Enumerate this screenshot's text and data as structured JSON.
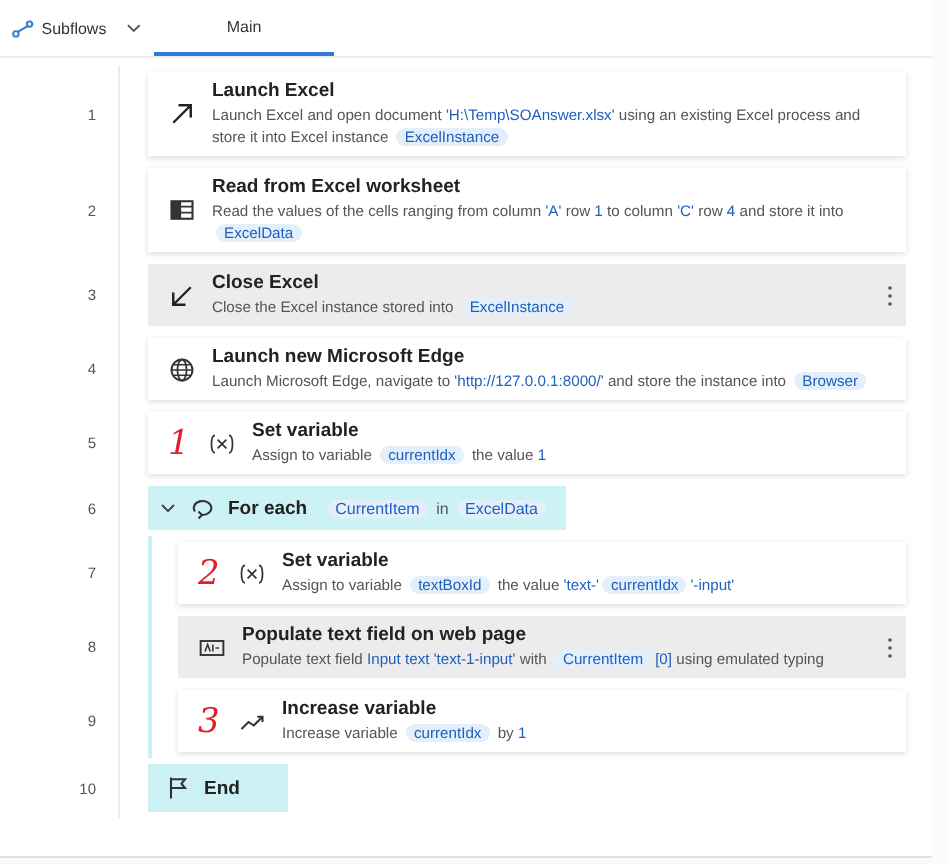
{
  "subflows": {
    "label": "Subflows"
  },
  "tabs": [
    {
      "label": "Main",
      "selected": true
    }
  ],
  "steps": [
    {
      "number": "1",
      "kind": "launch",
      "title": "Launch Excel",
      "highlighted": false,
      "description": [
        {
          "kind": "text",
          "text": "Launch Excel and open document "
        },
        {
          "kind": "value",
          "text": "'H:\\Temp\\SOAnswer.xlsx'"
        },
        {
          "kind": "text",
          "text": " using an existing Excel process and store it into Excel instance "
        },
        {
          "kind": "var",
          "text": "ExcelInstance"
        }
      ]
    },
    {
      "number": "2",
      "kind": "read",
      "title": "Read from Excel worksheet",
      "highlighted": false,
      "description": [
        {
          "kind": "text",
          "text": "Read the values of the cells ranging from column "
        },
        {
          "kind": "value",
          "text": "'A'"
        },
        {
          "kind": "text",
          "text": " row "
        },
        {
          "kind": "value",
          "text": "1"
        },
        {
          "kind": "text",
          "text": " to column "
        },
        {
          "kind": "value",
          "text": "'C'"
        },
        {
          "kind": "text",
          "text": " row "
        },
        {
          "kind": "value",
          "text": "4"
        },
        {
          "kind": "text",
          "text": " and store it into "
        },
        {
          "kind": "var",
          "text": "ExcelData"
        }
      ]
    },
    {
      "number": "3",
      "kind": "close",
      "title": "Close Excel",
      "highlighted": true,
      "description": [
        {
          "kind": "text",
          "text": "Close the Excel instance stored into "
        },
        {
          "kind": "var",
          "text": "ExcelInstance"
        }
      ]
    },
    {
      "number": "4",
      "kind": "browser",
      "title": "Launch new Microsoft Edge",
      "highlighted": false,
      "description": [
        {
          "kind": "text",
          "text": "Launch Microsoft Edge, navigate to "
        },
        {
          "kind": "value",
          "text": "'http://127.0.0.1:8000/'"
        },
        {
          "kind": "text",
          "text": " and store the instance into "
        },
        {
          "kind": "var",
          "text": "Browser"
        }
      ]
    },
    {
      "number": "5",
      "kind": "assign",
      "title": "Set variable",
      "annotation": "1",
      "highlighted": false,
      "description": [
        {
          "kind": "text",
          "text": "Assign to variable "
        },
        {
          "kind": "var",
          "text": "currentIdx"
        },
        {
          "kind": "text",
          "text": " the value "
        },
        {
          "kind": "value",
          "text": "1"
        }
      ]
    },
    {
      "number": "6",
      "kind": "loop",
      "title": "For each",
      "expanded": true,
      "description": [
        {
          "kind": "var",
          "text": "CurrentItem"
        },
        {
          "kind": "text",
          "text": " in "
        },
        {
          "kind": "var",
          "text": "ExcelData"
        }
      ],
      "children": [
        {
          "number": "7",
          "kind": "assign",
          "title": "Set variable",
          "annotation": "2",
          "highlighted": false,
          "description": [
            {
              "kind": "text",
              "text": "Assign to variable "
            },
            {
              "kind": "var",
              "text": "textBoxId"
            },
            {
              "kind": "text",
              "text": " the value "
            },
            {
              "kind": "value",
              "text": "'text-'"
            },
            {
              "kind": "var",
              "text": "currentIdx"
            },
            {
              "kind": "value",
              "text": "'-input'"
            }
          ]
        },
        {
          "number": "8",
          "kind": "populate",
          "title": "Populate text field on web page",
          "highlighted": true,
          "description": [
            {
              "kind": "text",
              "text": "Populate text field "
            },
            {
              "kind": "value",
              "text": "Input text 'text-1-input'"
            },
            {
              "kind": "text",
              "text": " with "
            },
            {
              "kind": "var",
              "text": "CurrentItem"
            },
            {
              "kind": "value",
              "text": "[0]"
            },
            {
              "kind": "text",
              "text": " using emulated typing"
            }
          ]
        },
        {
          "number": "9",
          "kind": "increase",
          "title": "Increase variable",
          "annotation": "3",
          "highlighted": false,
          "description": [
            {
              "kind": "text",
              "text": "Increase variable "
            },
            {
              "kind": "var",
              "text": "currentIdx"
            },
            {
              "kind": "text",
              "text": " by "
            },
            {
              "kind": "value",
              "text": "1"
            }
          ]
        }
      ]
    },
    {
      "number": "10",
      "kind": "end",
      "title": "End"
    }
  ]
}
